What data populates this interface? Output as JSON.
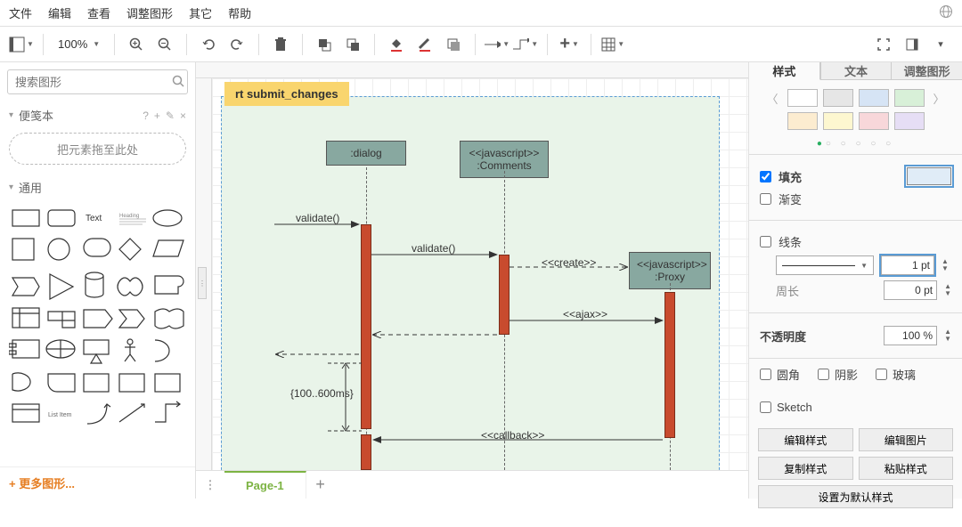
{
  "menu": {
    "file": "文件",
    "edit": "编辑",
    "view": "查看",
    "arrange": "调整图形",
    "extras": "其它",
    "help": "帮助"
  },
  "toolbar": {
    "zoom": "100%"
  },
  "search": {
    "placeholder": "搜索图形"
  },
  "scratchpad": {
    "title": "便笺本",
    "hint": "把元素拖至此处",
    "help": "?",
    "plus": "+",
    "edit": "✎",
    "close": "×"
  },
  "shapes": {
    "general_title": "通用",
    "text_label": "Text",
    "heading_label": "Heading",
    "list_item_label": "List Item"
  },
  "more_shapes": "+ 更多图形...",
  "page": {
    "tab1": "Page-1"
  },
  "diagram": {
    "frame_title": "rt submit_changes",
    "lifelines": {
      "dialog": ":dialog",
      "comments_stereo": "<<javascript>>",
      "comments": ":Comments",
      "proxy_stereo": "<<javascript>>",
      "proxy": ":Proxy"
    },
    "msgs": {
      "validate1": "validate()",
      "validate2": "validate()",
      "create": "<<create>>",
      "ajax": "<<ajax>>",
      "callback": "<<callback>>",
      "duration": "{100..600ms}"
    }
  },
  "right": {
    "tabs": {
      "style": "样式",
      "text": "文本",
      "arrange": "调整图形"
    },
    "swatches": [
      "#ffffff",
      "#e6e6e6",
      "#d6e4f5",
      "#d8f0d8",
      "#fcecd0",
      "#fdf7d0",
      "#f8d7da",
      "#e6def5"
    ],
    "fill": {
      "label": "填充"
    },
    "gradient": {
      "label": "渐变"
    },
    "line": {
      "label": "线条",
      "width": "1 pt",
      "perimeter_label": "周长",
      "perimeter": "0 pt"
    },
    "opacity": {
      "label": "不透明度",
      "value": "100 %"
    },
    "rounded": "圆角",
    "shadow": "阴影",
    "glass": "玻璃",
    "sketch": "Sketch",
    "btns": {
      "editStyle": "编辑样式",
      "editImage": "编辑图片",
      "copyStyle": "复制样式",
      "pasteStyle": "粘贴样式",
      "setDefault": "设置为默认样式"
    }
  }
}
